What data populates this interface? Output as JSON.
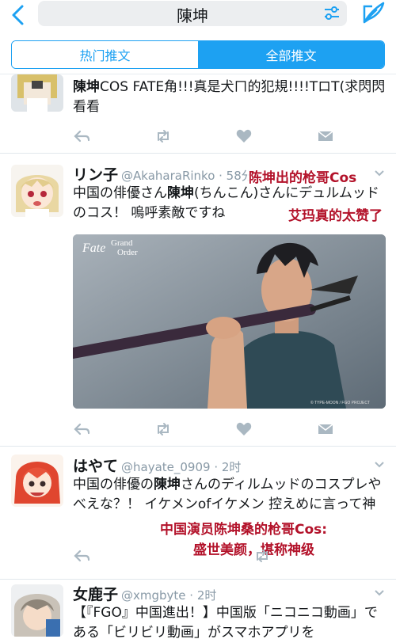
{
  "header": {
    "search_query": "陳坤"
  },
  "tabs": [
    {
      "label": "热门推文",
      "active": false
    },
    {
      "label": "全部推文",
      "active": true
    }
  ],
  "tweets": [
    {
      "text_bold": "陳坤",
      "text_rest": "COS FATE角!!!真是犬ㄇ的犯規!!!!TロT(求閃閃看看"
    },
    {
      "name": "リン子",
      "handle": "@AkaharaRinko · 58分",
      "text_pre": "中国の俳優さん",
      "text_bold": "陳坤",
      "text_post": "(ちんこん)さんにデュルムッドのコス！ 嗚呼素敵ですね",
      "annotation_1": "陈坤出的枪哥Cos",
      "annotation_2": "艾玛真的太赞了",
      "media_logo_main": "Fate",
      "media_logo_sub1": "Grand",
      "media_logo_sub2": "Order",
      "media_credit": "© TYPE-MOON / FGO PROJECT"
    },
    {
      "name": "はやて",
      "handle": "@hayate_0909 · 2时",
      "text_pre": "中国の俳優の",
      "text_bold": "陳坤",
      "text_post": "さんのディルムッドのコスプレやべえな？！ イケメンofイケメン 控えめに言って神",
      "annotation_1": "中国演员陈坤桑的枪哥Cos:",
      "annotation_2": "盛世美颜，堪称神级"
    },
    {
      "name": "女鹿子",
      "handle": "@xmgbyte · 2时",
      "text": "【『FGO』中国進出！】中国版「ニコニコ動画」である「ビリビリ動画」がスマホアプリを"
    }
  ],
  "colors": {
    "accent": "#1da1f2",
    "annotation": "#b3122a",
    "secondary_text": "#8899a6"
  }
}
